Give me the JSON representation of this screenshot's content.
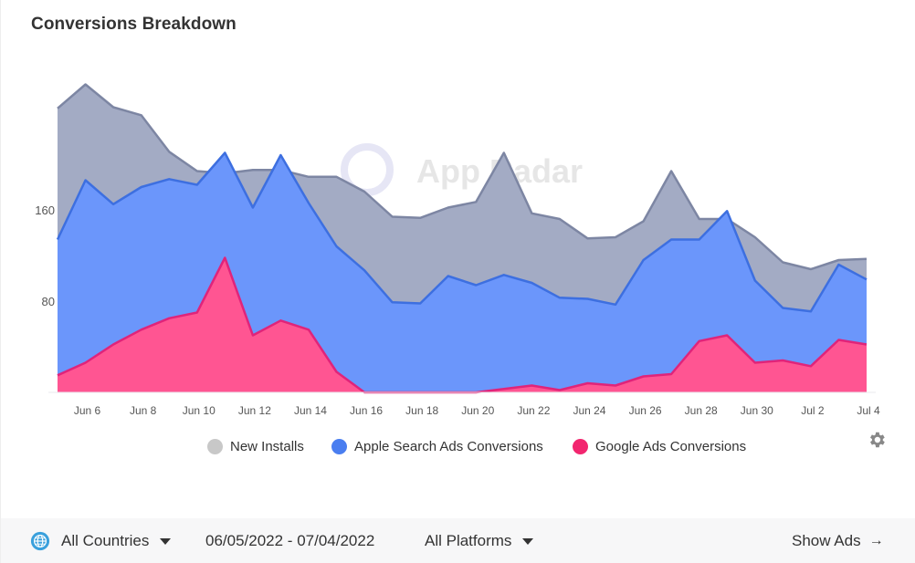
{
  "header": {
    "title": "Conversions Breakdown"
  },
  "watermark": {
    "text": "App Radar"
  },
  "chart_data": {
    "type": "area",
    "title": "Conversions Breakdown",
    "xlabel": "",
    "ylabel": "",
    "ylim": [
      0,
      280
    ],
    "yticks": [
      80,
      160
    ],
    "x": [
      "Jun 5",
      "Jun 6",
      "Jun 7",
      "Jun 8",
      "Jun 9",
      "Jun 10",
      "Jun 11",
      "Jun 12",
      "Jun 13",
      "Jun 14",
      "Jun 15",
      "Jun 16",
      "Jun 17",
      "Jun 18",
      "Jun 19",
      "Jun 20",
      "Jun 21",
      "Jun 22",
      "Jun 23",
      "Jun 24",
      "Jun 25",
      "Jun 26",
      "Jun 27",
      "Jun 28",
      "Jun 29",
      "Jun 30",
      "Jul 1",
      "Jul 2",
      "Jul 3",
      "Jul 4"
    ],
    "xtick_labels": [
      "Jun 6",
      "Jun 8",
      "Jun 10",
      "Jun 12",
      "Jun 14",
      "Jun 16",
      "Jun 18",
      "Jun 20",
      "Jun 22",
      "Jun 24",
      "Jun 26",
      "Jun 28",
      "Jun 30",
      "Jul 2",
      "Jul 4"
    ],
    "grid": false,
    "legend_position": "bottom",
    "series": [
      {
        "name": "New Installs",
        "color": "#a3abc4",
        "line_color": "#7d86a3",
        "dot_color": "#c8c8c8",
        "values": [
          249,
          270,
          250,
          243,
          211,
          194,
          192,
          195,
          195,
          189,
          189,
          176,
          154,
          153,
          162,
          167,
          210,
          157,
          152,
          135,
          136,
          150,
          194,
          152,
          152,
          136,
          114,
          108,
          116,
          117
        ]
      },
      {
        "name": "Apple Search Ads Conversions",
        "color": "#6b96fb",
        "line_color": "#3d6fe0",
        "dot_color": "#4a7ef0",
        "values": [
          134,
          186,
          165,
          180,
          187,
          182,
          210,
          162,
          208,
          166,
          128,
          107,
          79,
          78,
          102,
          94,
          103,
          96,
          83,
          82,
          77,
          116,
          134,
          134,
          159,
          98,
          74,
          71,
          112,
          99
        ]
      },
      {
        "name": "Google Ads Conversions",
        "color": "#ff5592",
        "line_color": "#e0247a",
        "dot_color": "#f2266f",
        "values": [
          15,
          26,
          42,
          55,
          65,
          70,
          118,
          50,
          63,
          55,
          18,
          0,
          0,
          0,
          0,
          0,
          3,
          6,
          2,
          8,
          6,
          14,
          16,
          45,
          50,
          26,
          28,
          23,
          46,
          42
        ]
      }
    ]
  },
  "footer": {
    "country_label": "All Countries",
    "date_range": "06/05/2022 - 07/04/2022",
    "platform_label": "All Platforms",
    "show_ads_label": "Show Ads",
    "arrow": "→"
  }
}
